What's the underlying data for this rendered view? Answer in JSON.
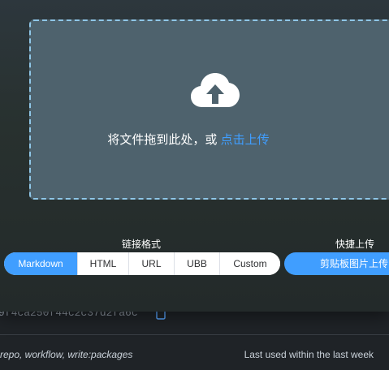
{
  "background": {
    "token_text": "9f4ca250f44c2c37d2fa6c",
    "scopes": "repo, workflow, write:packages",
    "last_used": "Last used within the last week"
  },
  "uploader": {
    "drop_text": "将文件拖到此处，或 ",
    "drop_link": "点击上传",
    "format_label": "链接格式",
    "formats": [
      "Markdown",
      "HTML",
      "URL",
      "UBB",
      "Custom"
    ],
    "selected_format": "Markdown",
    "quick_label": "快捷上传",
    "paste_button": "剪贴板图片上传"
  },
  "colors": {
    "accent": "#409eff",
    "dropzone_bg": "#4e626d",
    "dropzone_border": "#8fc7e8"
  },
  "icons": {
    "upload": "cloud-upload-icon",
    "copy": "copy-icon"
  }
}
